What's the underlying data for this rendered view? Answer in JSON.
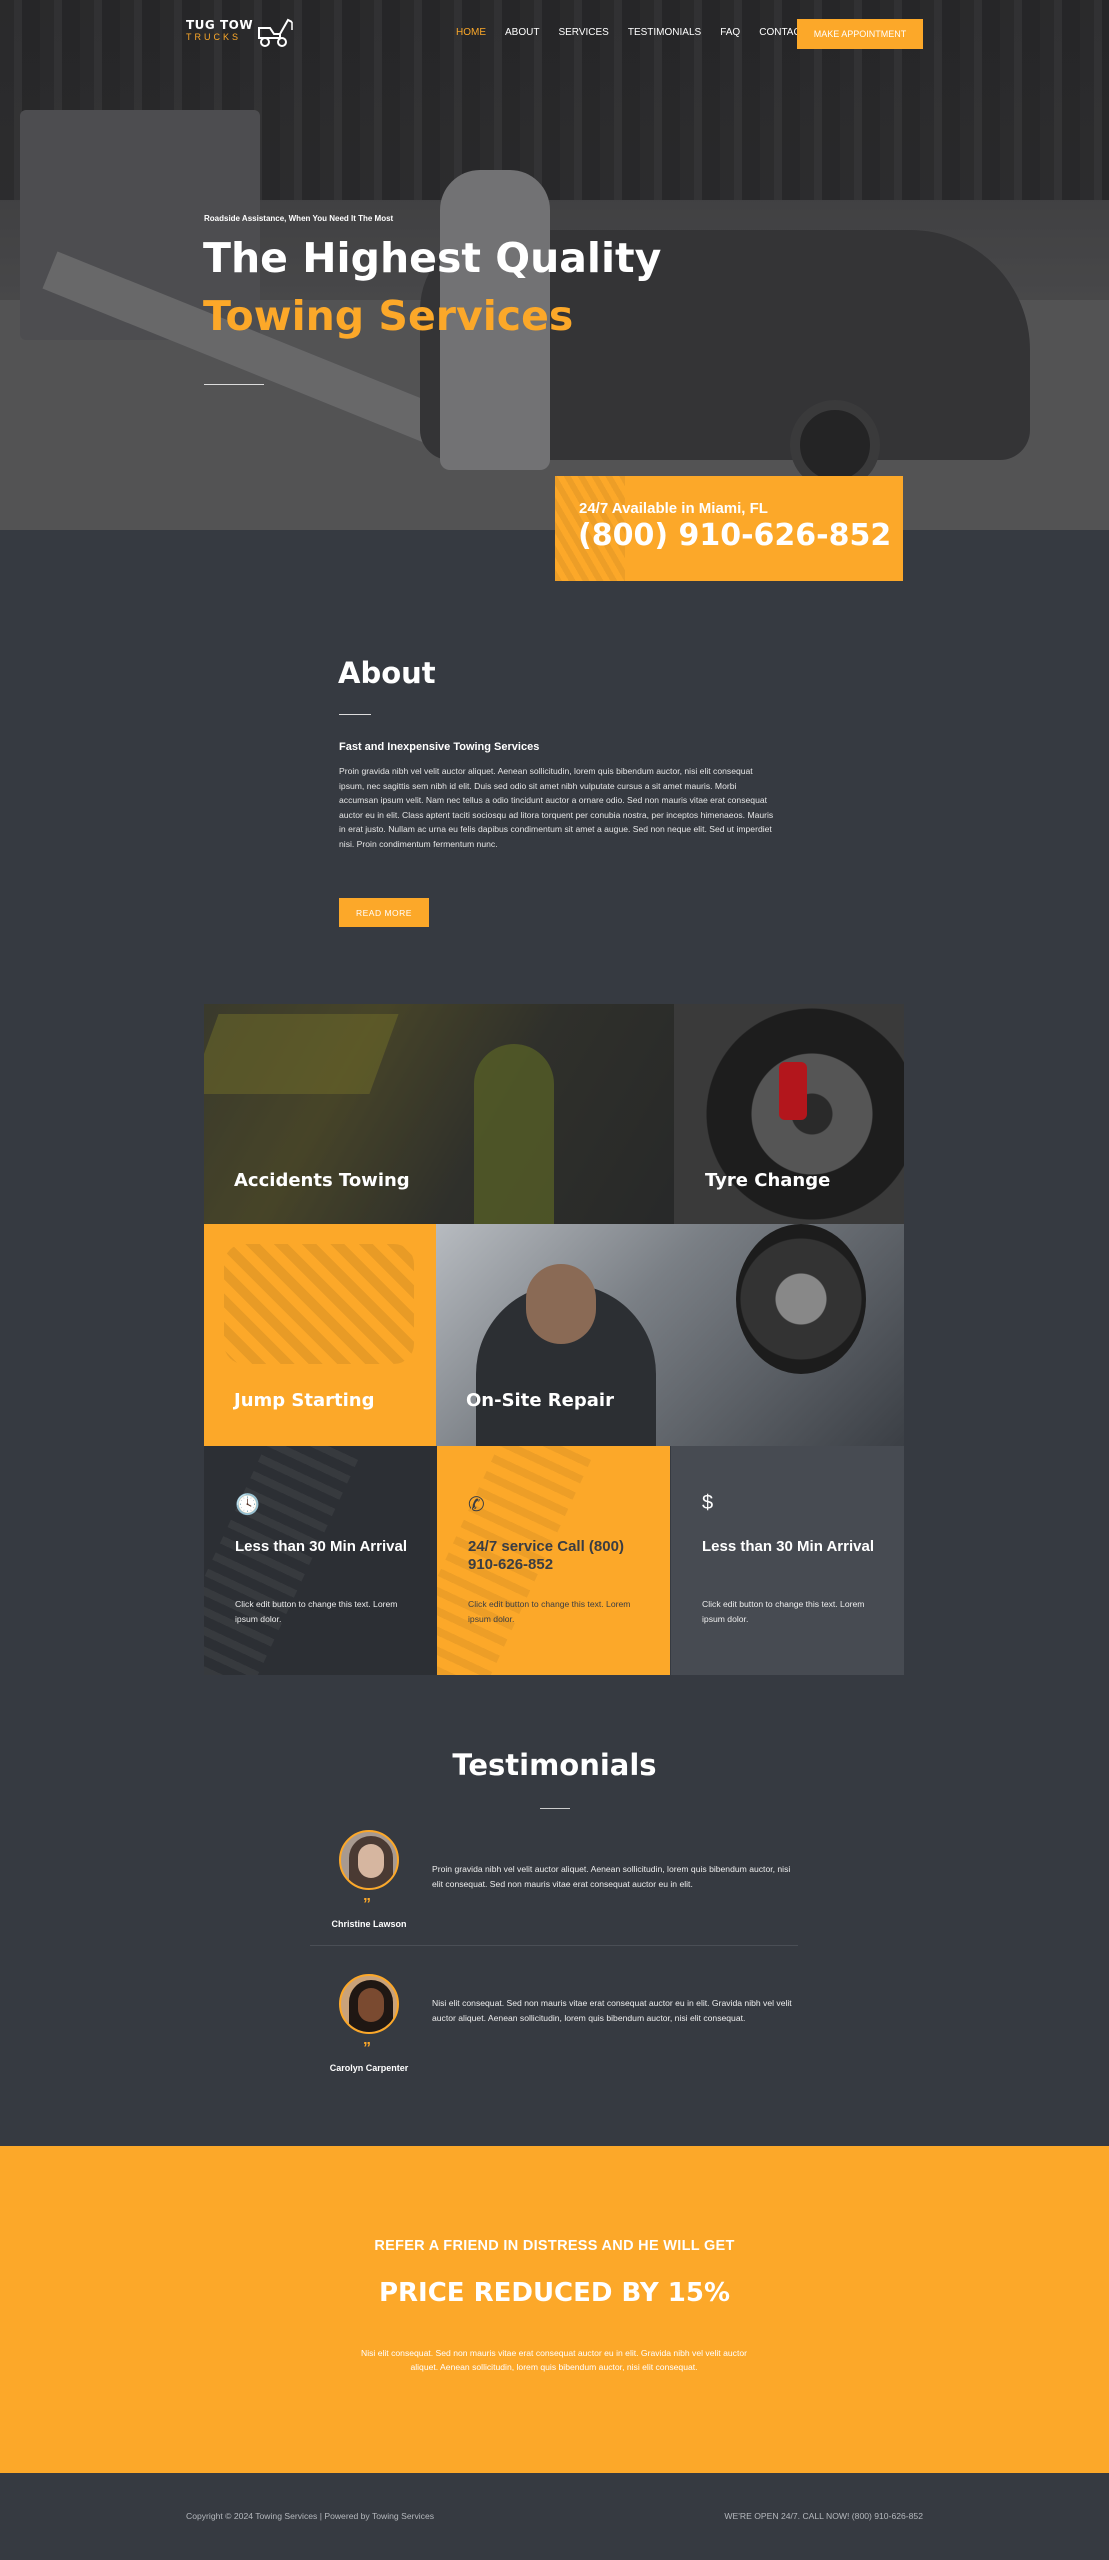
{
  "brand": {
    "line1": "TUG TOW",
    "line2": "TRUCKS"
  },
  "nav": {
    "items": [
      "HOME",
      "ABOUT",
      "SERVICES",
      "TESTIMONIALS",
      "FAQ",
      "CONTACT"
    ],
    "active": "HOME",
    "cta": "MAKE APPOINTMENT"
  },
  "hero": {
    "tagline": "Roadside Assistance, When You Need It The Most",
    "title_line1": "The Highest Quality",
    "title_line2": "Towing Services"
  },
  "callbox": {
    "availability": "24/7 Available in Miami, FL",
    "phone": "(800) 910-626-852"
  },
  "about": {
    "title": "About",
    "subtitle": "Fast and Inexpensive Towing Services",
    "text": "Proin gravida nibh vel velit auctor aliquet. Aenean sollicitudin, lorem quis bibendum auctor, nisi elit consequat ipsum, nec sagittis sem nibh id elit. Duis sed odio sit amet nibh vulputate cursus a sit amet mauris. Morbi accumsan ipsum velit. Nam nec tellus a odio tincidunt auctor a ornare odio. Sed non mauris vitae erat consequat auctor eu in elit. Class aptent taciti sociosqu ad litora torquent per conubia nostra, per inceptos himenaeos. Mauris in erat justo. Nullam ac urna eu felis dapibus condimentum sit amet a augue. Sed non neque elit. Sed ut imperdiet nisi. Proin condimentum fermentum nunc.",
    "button": "READ MORE"
  },
  "services": [
    {
      "label": "Accidents Towing"
    },
    {
      "label": "Tyre Change"
    },
    {
      "label": "Jump Starting"
    },
    {
      "label": "On-Site Repair"
    }
  ],
  "features": [
    {
      "icon": "clock-icon",
      "glyph": "🕓",
      "title": "Less than 30 Min Arrival",
      "text": "Click edit button to change this text. Lorem ipsum dolor."
    },
    {
      "icon": "phone-icon",
      "glyph": "✆",
      "title": "24/7 service Call (800) 910-626-852",
      "text": "Click edit button to change this text. Lorem ipsum dolor."
    },
    {
      "icon": "dollar-icon",
      "glyph": "$",
      "title": "Less than 30 Min Arrival",
      "text": "Click edit button to change this text. Lorem ipsum dolor."
    }
  ],
  "testimonials": {
    "title": "Testimonials",
    "items": [
      {
        "name": "Christine Lawson",
        "quote_mark": "”",
        "text": "Proin gravida nibh vel velit auctor aliquet. Aenean sollicitudin, lorem quis bibendum auctor, nisi elit consequat. Sed non mauris vitae erat consequat auctor eu in elit."
      },
      {
        "name": "Carolyn Carpenter",
        "quote_mark": "”",
        "text": "Nisi elit consequat. Sed non mauris vitae erat consequat auctor eu in elit. Gravida nibh vel velit auctor aliquet. Aenean sollicitudin, lorem quis bibendum auctor, nisi elit consequat."
      }
    ]
  },
  "promo": {
    "line1": "REFER A FRIEND IN DISTRESS AND HE WILL GET",
    "line2": "PRICE REDUCED BY 15%",
    "text": "Nisi elit consequat. Sed non mauris vitae erat consequat auctor eu in elit. Gravida nibh vel velit auctor aliquet. Aenean sollicitudin, lorem quis bibendum auctor, nisi elit consequat."
  },
  "footer": {
    "left": "Copyright © 2024 Towing Services | Powered by Towing Services",
    "right": "WE'RE OPEN 24/7. CALL NOW! (800) 910-626-852"
  },
  "colors": {
    "accent": "#fca829",
    "dark": "#363a41",
    "darker": "#2c2f34",
    "mid": "#474b52"
  }
}
